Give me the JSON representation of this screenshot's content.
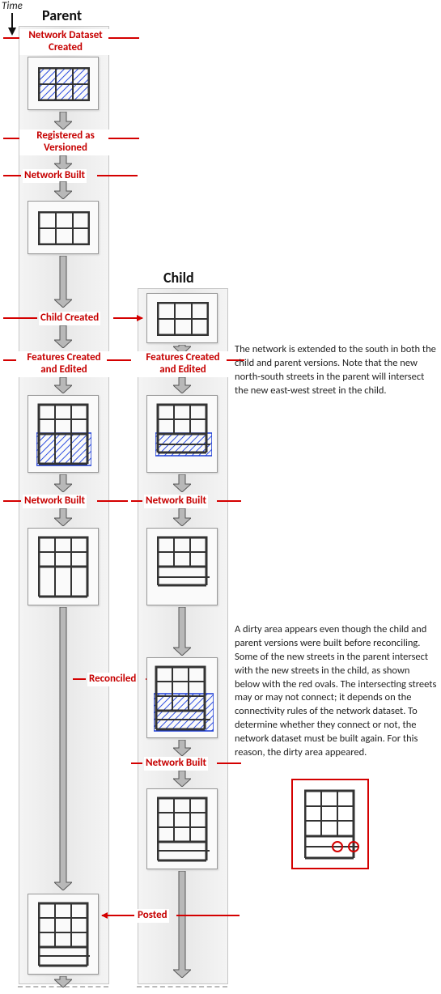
{
  "time_label": "Time",
  "columns": {
    "parent": "Parent",
    "child": "Child"
  },
  "events": {
    "nd_created": "Network Dataset Created",
    "registered": "Registered as Versioned",
    "net_built": "Network Built",
    "child_created": "Child Created",
    "features_edited": "Features Created and Edited",
    "reconciled": "Reconciled",
    "posted": "Posted"
  },
  "paragraphs": {
    "p1": "The network is extended to the south in both the child and parent versions. Note that the new north-south streets in the parent will intersect the new east-west street in the child.",
    "p2": "A dirty area appears even though the child and parent versions were built before reconciling. Some of the new streets in the parent intersect with the new streets in the child, as shown below with the red ovals. The intersecting streets may or may not connect; it depends on the connectivity rules of the network dataset. To determine whether they connect or not, the network dataset must be built again. For this reason, the dirty area appeared."
  },
  "chart_data": {
    "type": "flow-diagram",
    "time_axis": "vertical-down",
    "lanes": [
      "Parent",
      "Child"
    ],
    "steps": [
      {
        "lane": "Parent",
        "event": "Network Dataset Created",
        "state": "grid-2x3-dirty-full"
      },
      {
        "lane": "Parent",
        "event": "Registered as Versioned"
      },
      {
        "lane": "Parent",
        "event": "Network Built",
        "state": "grid-2x3-clean"
      },
      {
        "lane": "both",
        "event": "Child Created",
        "child_state": "grid-2x3-clean"
      },
      {
        "lane": "both",
        "event": "Features Created and Edited",
        "parent_state": "grid-2x3-extended-south-NS-dirty-bottom",
        "child_state": "grid-2x3-extended-south-EW-dirty-bottom"
      },
      {
        "lane": "both",
        "event": "Network Built",
        "parent_state": "grid-2x3-extended-south-NS-clean",
        "child_state": "grid-2x3-extended-south-EW-clean"
      },
      {
        "lane": "Child",
        "event": "Reconciled",
        "state": "grid-3x3-merged-dirty-bottom"
      },
      {
        "lane": "Child",
        "event": "Network Built",
        "state": "grid-3x3-merged-clean"
      },
      {
        "lane": "Parent",
        "event": "Posted",
        "from": "Child",
        "state": "grid-3x3-merged-clean"
      }
    ],
    "inset": {
      "description": "grid-3x3-merged with two intersection points circled in red on bottom-right east-west street",
      "intersections_circled": 2
    }
  }
}
